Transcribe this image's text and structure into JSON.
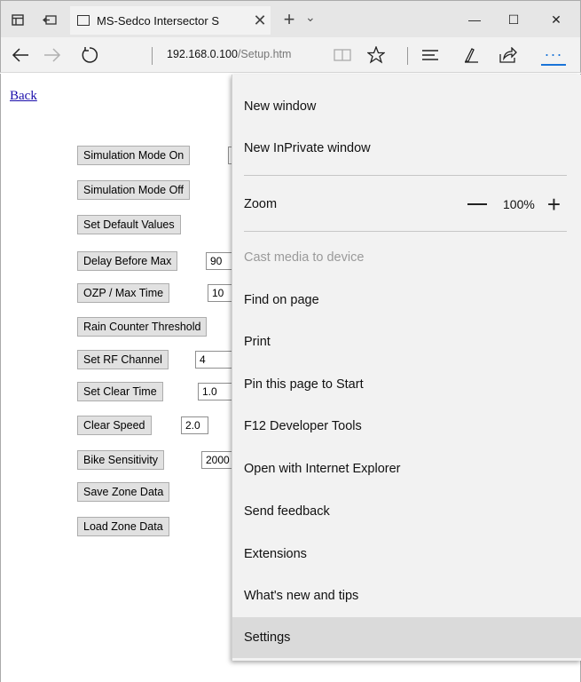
{
  "titlebar": {
    "tab_title": "MS-Sedco Intersector S",
    "close_tab": "✕",
    "new_tab": "+",
    "tab_list": "⌄",
    "minimize": "—",
    "maximize": "☐",
    "close_window": "✕"
  },
  "navbar": {
    "url_host": "192.168.0.100",
    "url_path": "/Setup.htm",
    "icons": [
      "back-arrow-icon",
      "forward-arrow-icon",
      "refresh-icon",
      "reading-view-icon",
      "favorite-star-icon",
      "hub-icon",
      "web-note-icon",
      "share-icon",
      "more-icon"
    ]
  },
  "page": {
    "back_link": "Back",
    "buttons": [
      {
        "label": "Simulation Mode On",
        "input": ""
      },
      {
        "label": "Simulation Mode Off",
        "input": null
      },
      {
        "label": "Set Default Values",
        "input": null
      },
      {
        "label": "Delay Before Max",
        "input": "90"
      },
      {
        "label": "OZP / Max Time",
        "input": "10"
      },
      {
        "label": "Rain Counter Threshold",
        "input": null
      },
      {
        "label": "Set RF Channel",
        "input": "4"
      },
      {
        "label": "Set Clear Time",
        "input": "1.0"
      },
      {
        "label": "Clear Speed",
        "input": "2.0"
      },
      {
        "label": "Bike Sensitivity",
        "input": "2000"
      },
      {
        "label": "Save Zone Data",
        "input": null
      },
      {
        "label": "Load Zone Data",
        "input": null
      }
    ]
  },
  "menu": {
    "new_window": "New window",
    "new_inprivate": "New InPrivate window",
    "zoom_label": "Zoom",
    "zoom_value": "100%",
    "zoom_plus": "+",
    "cast": "Cast media to device",
    "find": "Find on page",
    "print": "Print",
    "pin": "Pin this page to Start",
    "devtools": "F12 Developer Tools",
    "open_ie": "Open with Internet Explorer",
    "feedback": "Send feedback",
    "extensions": "Extensions",
    "whats_new": "What's new and tips",
    "settings": "Settings"
  }
}
